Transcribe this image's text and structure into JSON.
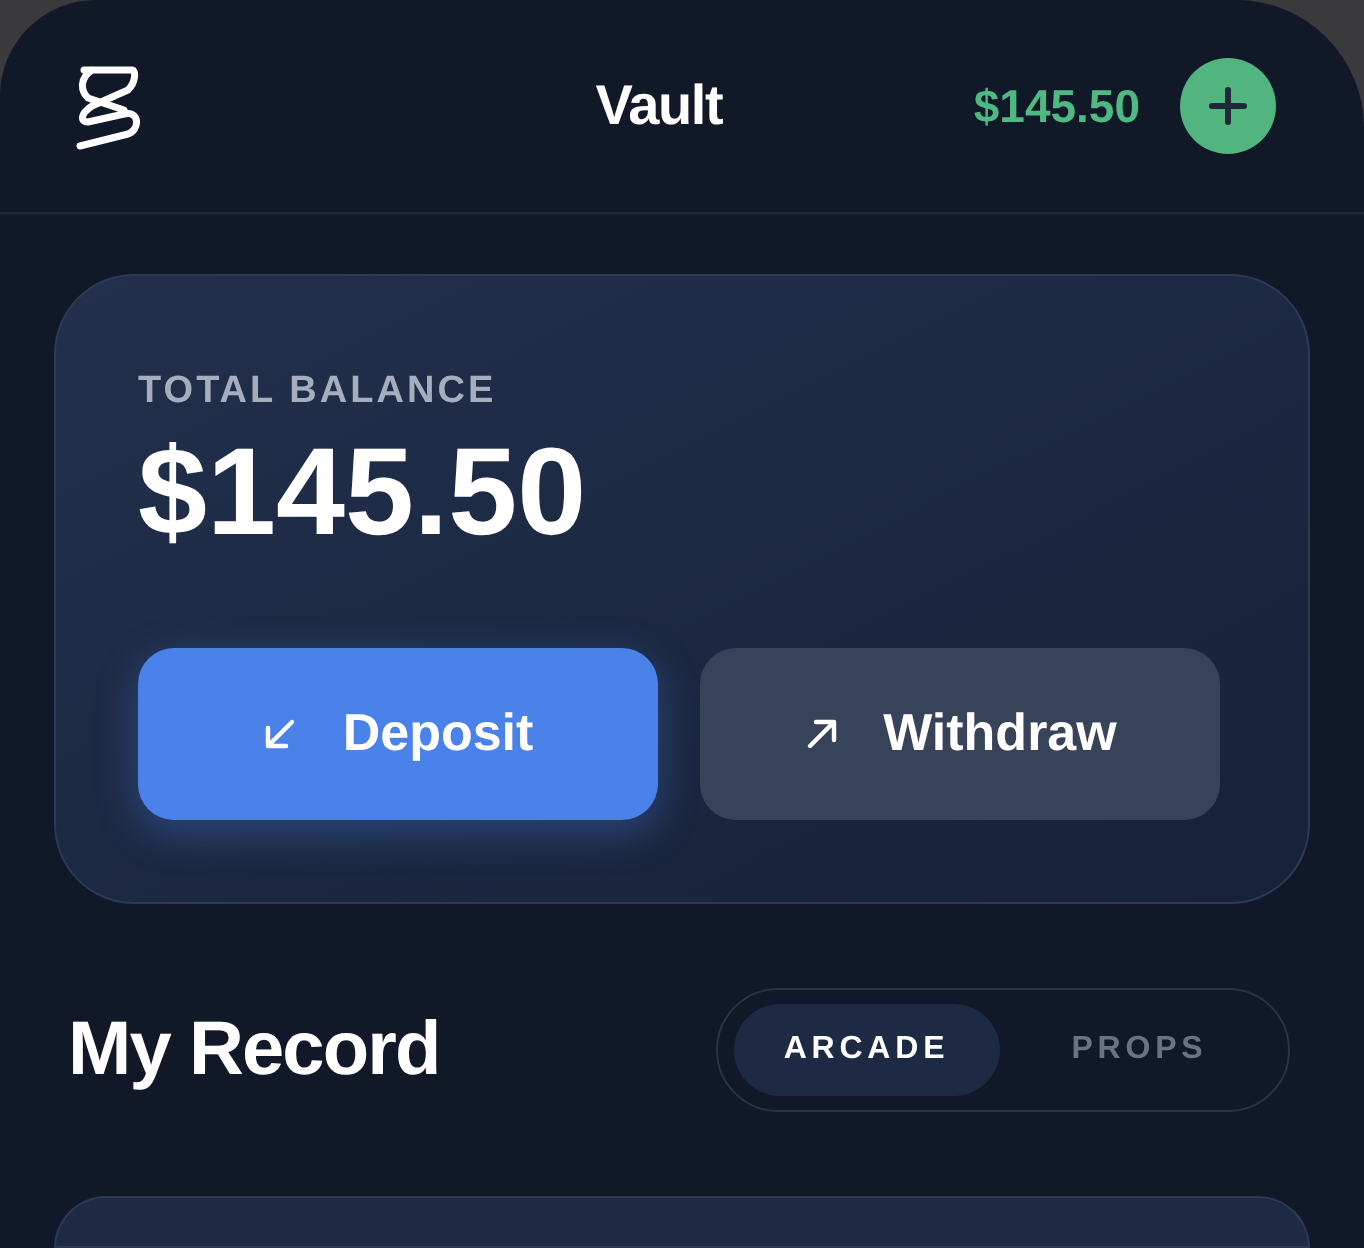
{
  "header": {
    "title": "Vault",
    "balance": "$145.50"
  },
  "balance_card": {
    "label": "TOTAL BALANCE",
    "amount": "$145.50",
    "buttons": [
      {
        "label": "Deposit",
        "kind": "deposit"
      },
      {
        "label": "Withdraw",
        "kind": "withdraw"
      }
    ]
  },
  "record": {
    "title": "My Record",
    "tabs": [
      {
        "label": "ARCADE",
        "selected": true
      },
      {
        "label": "PROPS",
        "selected": false
      }
    ]
  }
}
